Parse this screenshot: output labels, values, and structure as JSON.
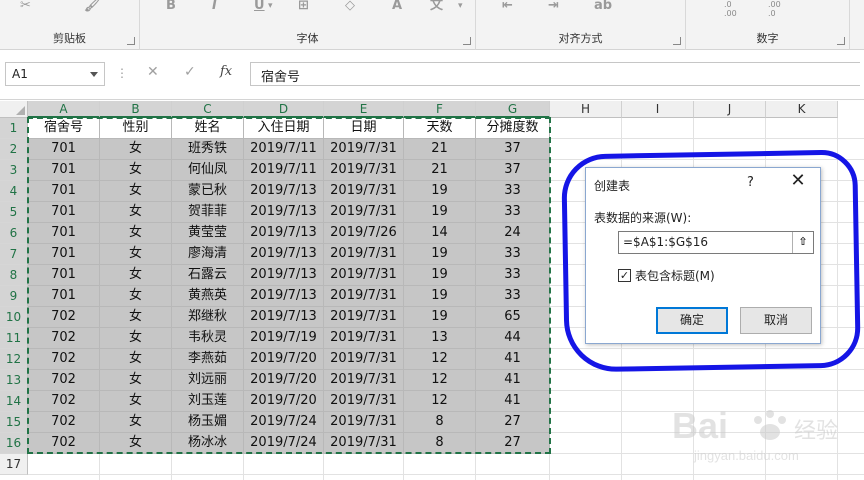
{
  "ribbon": {
    "groups": [
      {
        "label": "剪贴板"
      },
      {
        "label": "字体"
      },
      {
        "label": "对齐方式"
      },
      {
        "label": "数字"
      }
    ],
    "number_icon_texts": [
      ".0\n.00",
      ".00\n.0"
    ]
  },
  "formula_bar": {
    "name_box": "A1",
    "separator": "⋮",
    "formula": "宿舍号"
  },
  "columns": [
    "A",
    "B",
    "C",
    "D",
    "E",
    "F",
    "G",
    "H",
    "I",
    "J",
    "K"
  ],
  "rows": [
    "1",
    "2",
    "3",
    "4",
    "5",
    "6",
    "7",
    "8",
    "9",
    "10",
    "11",
    "12",
    "13",
    "14",
    "15",
    "16",
    "17"
  ],
  "table": {
    "headers": [
      "宿舍号",
      "性别",
      "姓名",
      "入住日期",
      "日期",
      "天数",
      "分摊度数"
    ],
    "rows": [
      [
        "701",
        "女",
        "班秀铁",
        "2019/7/11",
        "2019/7/31",
        "21",
        "37"
      ],
      [
        "701",
        "女",
        "何仙凤",
        "2019/7/11",
        "2019/7/31",
        "21",
        "37"
      ],
      [
        "701",
        "女",
        "蒙已秋",
        "2019/7/13",
        "2019/7/31",
        "19",
        "33"
      ],
      [
        "701",
        "女",
        "贺菲菲",
        "2019/7/13",
        "2019/7/31",
        "19",
        "33"
      ],
      [
        "701",
        "女",
        "黄莹莹",
        "2019/7/13",
        "2019/7/26",
        "14",
        "24"
      ],
      [
        "701",
        "女",
        "廖海清",
        "2019/7/13",
        "2019/7/31",
        "19",
        "33"
      ],
      [
        "701",
        "女",
        "石露云",
        "2019/7/13",
        "2019/7/31",
        "19",
        "33"
      ],
      [
        "701",
        "女",
        "黄燕英",
        "2019/7/13",
        "2019/7/31",
        "19",
        "33"
      ],
      [
        "702",
        "女",
        "郑继秋",
        "2019/7/13",
        "2019/7/31",
        "19",
        "65"
      ],
      [
        "702",
        "女",
        "韦秋灵",
        "2019/7/19",
        "2019/7/31",
        "13",
        "44"
      ],
      [
        "702",
        "女",
        "李燕茹",
        "2019/7/20",
        "2019/7/31",
        "12",
        "41"
      ],
      [
        "702",
        "女",
        "刘远丽",
        "2019/7/20",
        "2019/7/31",
        "12",
        "41"
      ],
      [
        "702",
        "女",
        "刘玉莲",
        "2019/7/20",
        "2019/7/31",
        "12",
        "41"
      ],
      [
        "702",
        "女",
        "杨玉媚",
        "2019/7/24",
        "2019/7/31",
        "8",
        "27"
      ],
      [
        "702",
        "女",
        "杨冰冰",
        "2019/7/24",
        "2019/7/31",
        "8",
        "27"
      ]
    ]
  },
  "dialog": {
    "title": "创建表",
    "help": "?",
    "close": "✕",
    "source_label": "表数据的来源(W):",
    "source_value": "=$A$1:$G$16",
    "has_headers_label": "表包含标题(M)",
    "has_headers_checked": true,
    "ok_label": "确定",
    "cancel_label": "取消"
  },
  "watermark": {
    "brand": "Bai",
    "brand_cn": "经验",
    "url": "jingyan.baidu.com"
  },
  "colors": {
    "selection_green": "#217346",
    "annotation_blue": "#1515e6",
    "selected_fill": "#c6c6c6",
    "default_button_border": "#0078d7"
  }
}
